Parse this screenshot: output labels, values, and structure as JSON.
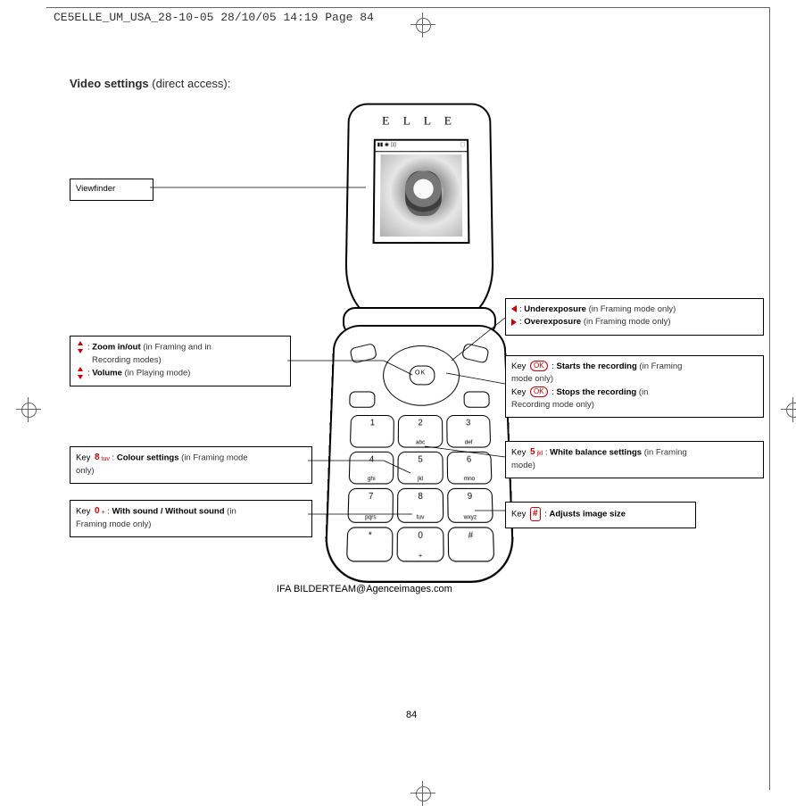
{
  "header": "CE5ELLE_UM_USA_28-10-05  28/10/05  14:19  Page 84",
  "title_strong": "Video settings",
  "title_rest": " (direct access):",
  "page_number": "84",
  "credit": "IFA BILDERTEAM@Agenceimages.com",
  "brand": "E L L E",
  "ok_label": "OK",
  "viewfinder": {
    "label": "Viewfinder"
  },
  "zoom_box": {
    "line1_prefix": ":  ",
    "line1_bold": "Zoom in/out",
    "line1_note": " (in Framing and in",
    "line1b": "Recording modes)",
    "line2_prefix": ":  ",
    "line2_bold": "Volume",
    "line2_note": " (in Playing mode)"
  },
  "colour_box": {
    "pre": "Key ",
    "key_num": "8",
    "key_sub": "tuv",
    "mid": " : ",
    "bold": "Colour settings",
    "note": " (in Framing mode",
    "note2": "only)"
  },
  "sound_box": {
    "pre": "Key ",
    "key_num": "0",
    "key_sub": "+",
    "mid": " : ",
    "bold": "With sound / Without sound",
    "note": " (in",
    "note2": "Framing mode only)"
  },
  "expo_box": {
    "l1_prefix": ":   ",
    "l1_bold": "Underexposure",
    "l1_note": " (in Framing mode only)",
    "l2_prefix": ":   ",
    "l2_bold": "Overexposure",
    "l2_note": " (in Framing mode only)"
  },
  "rec_box": {
    "a_pre": "Key ",
    "a_mid": " : ",
    "a_bold": "Starts the recording",
    "a_note": " (in Framing",
    "a_note2": "mode only)",
    "b_pre": "Key ",
    "b_mid": " : ",
    "b_bold": "Stops the recording",
    "b_note": " (in",
    "b_note2": "Recording mode only)"
  },
  "wb_box": {
    "pre": "Key ",
    "key_num": "5",
    "key_sub": "jkl",
    "mid": " : ",
    "bold": "White balance settings",
    "note": " (in Framing",
    "note2": "mode)"
  },
  "size_box": {
    "pre": "Key ",
    "hash": "#",
    "mid": " : ",
    "bold": "Adjusts image size"
  },
  "keys": {
    "1": {
      "n": "1",
      "s": ""
    },
    "2": {
      "n": "2",
      "s": "abc"
    },
    "3": {
      "n": "3",
      "s": "def"
    },
    "4": {
      "n": "4",
      "s": "ghi"
    },
    "5": {
      "n": "5",
      "s": "jkl"
    },
    "6": {
      "n": "6",
      "s": "mno"
    },
    "7": {
      "n": "7",
      "s": "pqrs"
    },
    "8": {
      "n": "8",
      "s": "tuv"
    },
    "9": {
      "n": "9",
      "s": "wxyz"
    },
    "star": {
      "n": "*",
      "s": ""
    },
    "0": {
      "n": "0",
      "s": "+"
    },
    "hash": {
      "n": "#",
      "s": ""
    }
  }
}
